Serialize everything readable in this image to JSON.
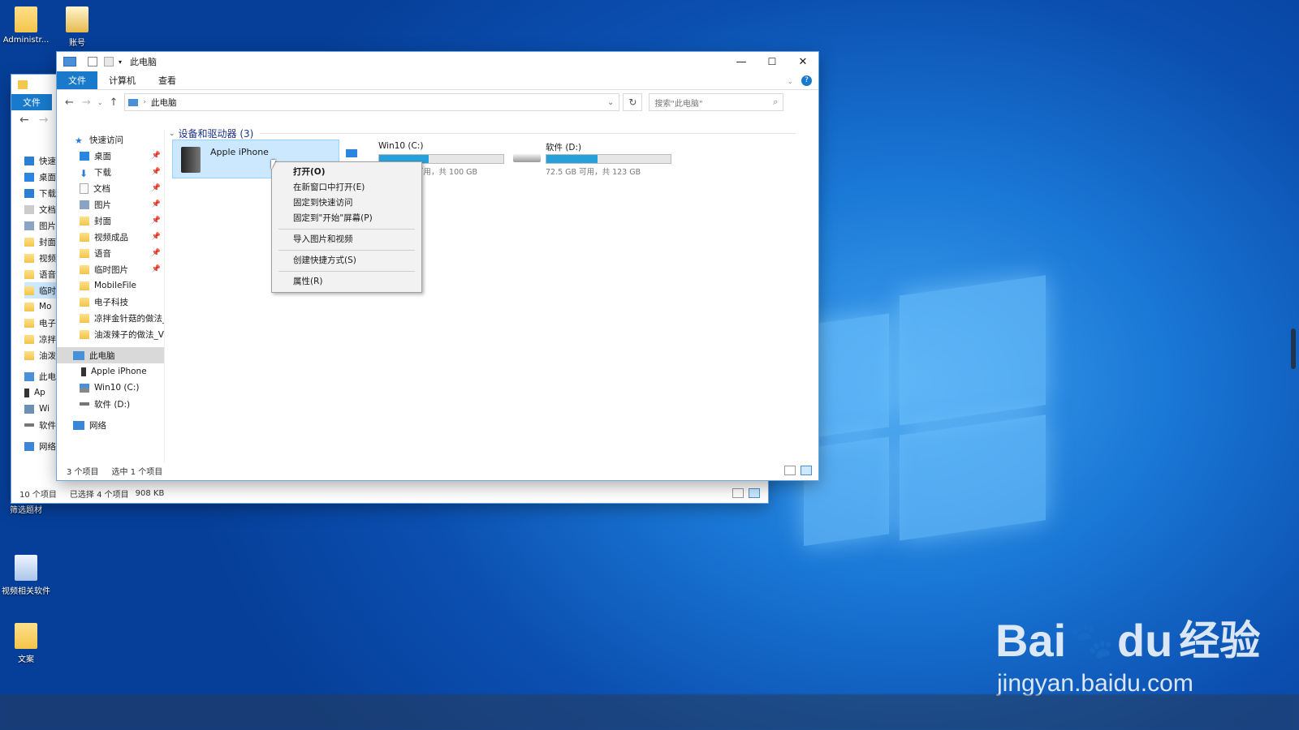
{
  "desktop": {
    "icons": [
      "Administr...",
      "账号",
      "筛选题材",
      "视频相关软件",
      "文案"
    ],
    "watermark": {
      "brand": "Bai",
      "paw": "du",
      "cn": "经验",
      "url": "jingyan.baidu.com"
    }
  },
  "back_window": {
    "file_tab": "文件",
    "tree": [
      "快速",
      "桌面",
      "下载",
      "文档",
      "图片",
      "封面",
      "视频",
      "语音",
      "临时",
      "Mo",
      "电子",
      "凉拌",
      "油泼",
      "此电",
      "Ap",
      "Wi",
      "软件",
      "网络"
    ],
    "status": {
      "count": "10 个项目",
      "selected": "已选择 4 个项目",
      "size": "908 KB"
    }
  },
  "window": {
    "title": "此电脑",
    "ribbon_tabs": [
      "文件",
      "计算机",
      "查看"
    ],
    "address": "此电脑",
    "search_placeholder": "搜索\"此电脑\"",
    "nav": {
      "quick_access": "快速访问",
      "quick_items": [
        "桌面",
        "下载",
        "文档",
        "图片",
        "封面",
        "视频成品",
        "语音",
        "临时图片",
        "MobileFile",
        "电子科技",
        "凉拌金针菇的做法_\\",
        "油泼辣子的做法_Vi"
      ],
      "this_pc": "此电脑",
      "pc_items": [
        "Apple iPhone",
        "Win10 (C:)",
        "软件 (D:)"
      ],
      "network": "网络"
    },
    "section_title": "设备和驱动器 (3)",
    "devices": [
      {
        "name": "Apple iPhone",
        "icon": "phone-icon"
      },
      {
        "name": "Win10 (C:)",
        "info": "可用，共 100 GB",
        "usage": 0.4
      },
      {
        "name": "软件 (D:)",
        "info": "72.5 GB 可用，共 123 GB",
        "usage": 0.41
      }
    ],
    "status": {
      "count": "3 个项目",
      "selected": "选中 1 个项目"
    }
  },
  "context_menu": [
    "打开(O)",
    "在新窗口中打开(E)",
    "固定到快速访问",
    "固定到\"开始\"屏幕(P)",
    "导入图片和视频",
    "创建快捷方式(S)",
    "属性(R)"
  ]
}
